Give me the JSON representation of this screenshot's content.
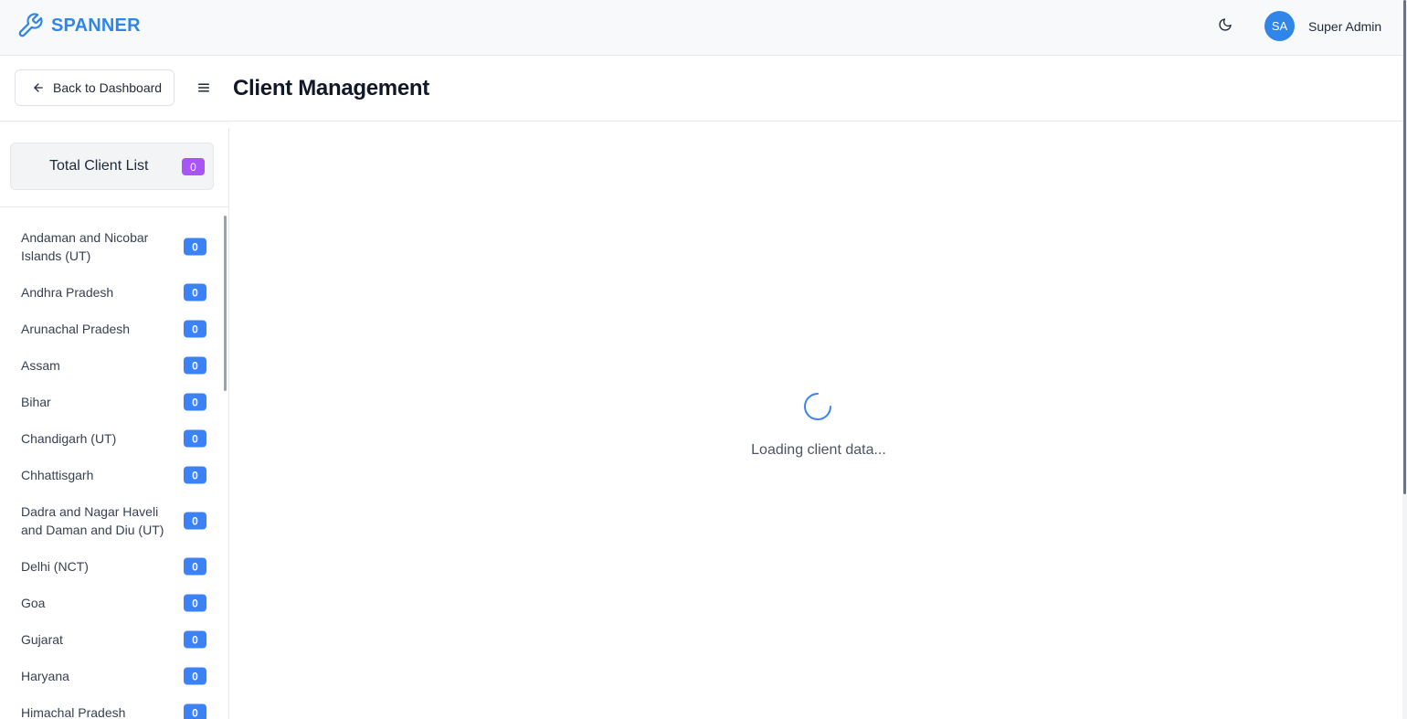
{
  "app": {
    "brand_name": "SPANNER",
    "brand_icon": "wrench-icon",
    "brand_color": "#2f86e8"
  },
  "user": {
    "initials": "SA",
    "name": "Super Admin",
    "avatar_color": "#2f86e8"
  },
  "theme_toggle_icon": "moon-icon",
  "header": {
    "back_label": "Back to Dashboard",
    "back_icon": "arrow-left-icon",
    "menu_icon": "hamburger-menu-icon",
    "title": "Client Management"
  },
  "sidebar": {
    "total_label": "Total Client List",
    "total_count": "0",
    "total_badge_color": "#a855f7",
    "state_badge_color": "#3b82f6",
    "states": [
      {
        "name": "Andaman and Nicobar Islands (UT)",
        "count": "0"
      },
      {
        "name": "Andhra Pradesh",
        "count": "0"
      },
      {
        "name": "Arunachal Pradesh",
        "count": "0"
      },
      {
        "name": "Assam",
        "count": "0"
      },
      {
        "name": "Bihar",
        "count": "0"
      },
      {
        "name": "Chandigarh (UT)",
        "count": "0"
      },
      {
        "name": "Chhattisgarh",
        "count": "0"
      },
      {
        "name": "Dadra and Nagar Haveli and Daman and Diu (UT)",
        "count": "0"
      },
      {
        "name": "Delhi (NCT)",
        "count": "0"
      },
      {
        "name": "Goa",
        "count": "0"
      },
      {
        "name": "Gujarat",
        "count": "0"
      },
      {
        "name": "Haryana",
        "count": "0"
      },
      {
        "name": "Himachal Pradesh",
        "count": "0"
      }
    ]
  },
  "main": {
    "spinner_icon": "loading-spinner-icon",
    "loading_text": "Loading client data..."
  }
}
